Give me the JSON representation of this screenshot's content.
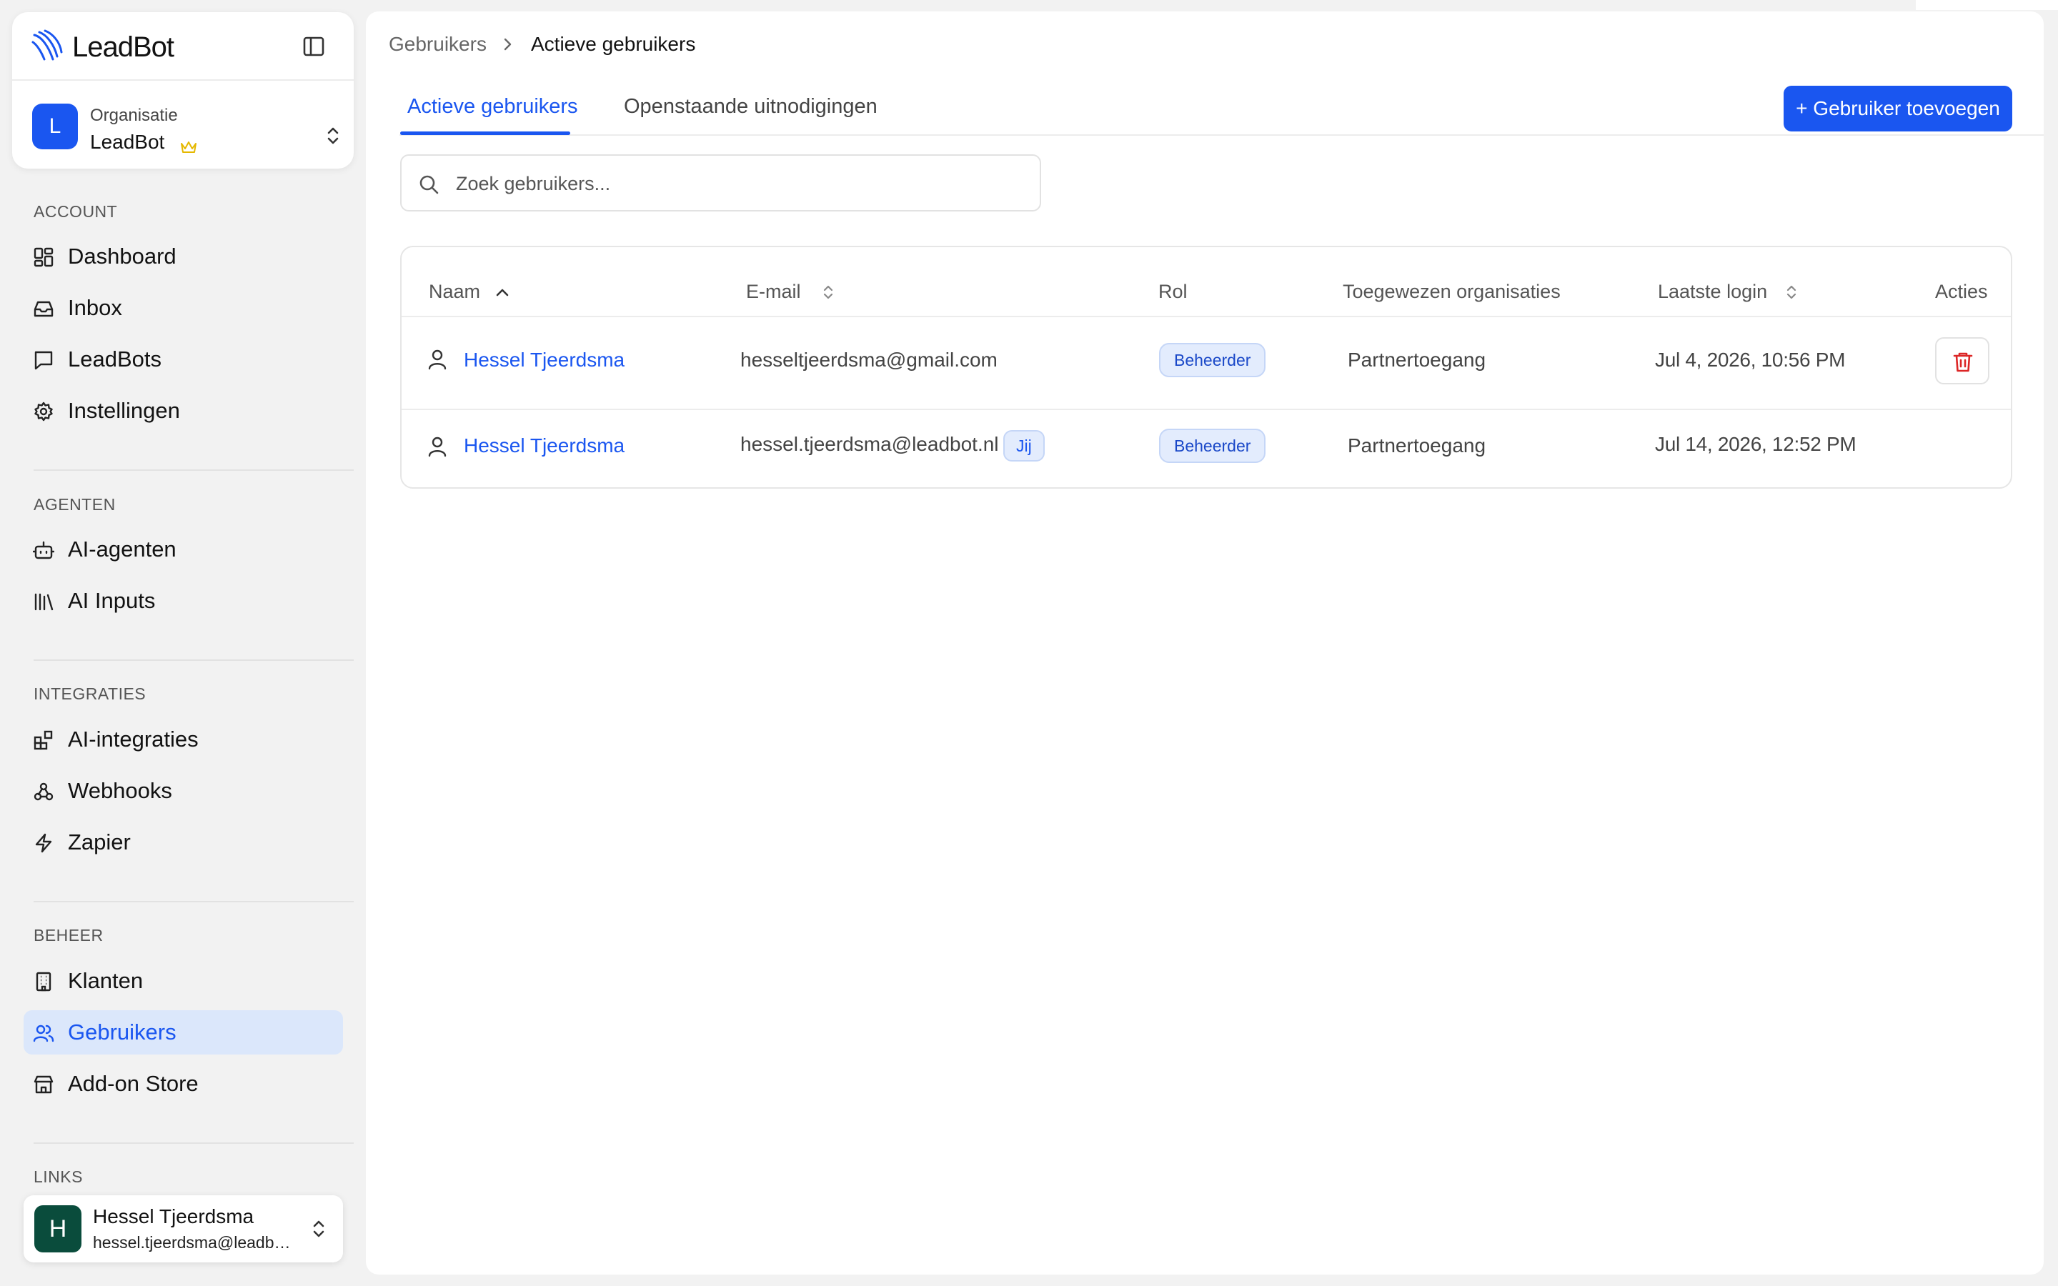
{
  "brand": {
    "name": "LeadBot"
  },
  "organization": {
    "label": "Organisatie",
    "name": "LeadBot",
    "avatar_letter": "L"
  },
  "sidebar": {
    "sections": [
      {
        "label": "ACCOUNT",
        "items": [
          {
            "label": "Dashboard",
            "icon": "dashboard-icon"
          },
          {
            "label": "Inbox",
            "icon": "inbox-icon"
          },
          {
            "label": "LeadBots",
            "icon": "chat-icon"
          },
          {
            "label": "Instellingen",
            "icon": "gear-icon"
          }
        ]
      },
      {
        "label": "AGENTEN",
        "items": [
          {
            "label": "AI-agenten",
            "icon": "bot-icon"
          },
          {
            "label": "AI Inputs",
            "icon": "library-icon"
          }
        ]
      },
      {
        "label": "INTEGRATIES",
        "items": [
          {
            "label": "AI-integraties",
            "icon": "blocks-icon"
          },
          {
            "label": "Webhooks",
            "icon": "webhook-icon"
          },
          {
            "label": "Zapier",
            "icon": "zap-icon"
          }
        ]
      },
      {
        "label": "BEHEER",
        "items": [
          {
            "label": "Klanten",
            "icon": "building-icon"
          },
          {
            "label": "Gebruikers",
            "icon": "users-icon",
            "active": true
          },
          {
            "label": "Add-on Store",
            "icon": "store-icon"
          }
        ]
      },
      {
        "label": "LINKS",
        "items": []
      }
    ]
  },
  "current_user": {
    "avatar_letter": "H",
    "name": "Hessel Tjeerdsma",
    "email": "hessel.tjeerdsma@leadbot.nl"
  },
  "breadcrumb": {
    "parent": "Gebruikers",
    "current": "Actieve gebruikers"
  },
  "tabs": [
    {
      "label": "Actieve gebruikers",
      "active": true
    },
    {
      "label": "Openstaande uitnodigingen",
      "active": false
    }
  ],
  "add_button": {
    "label": "+ Gebruiker toevoegen"
  },
  "search": {
    "placeholder": "Zoek gebruikers...",
    "value": ""
  },
  "table": {
    "columns": [
      "Naam",
      "E-mail",
      "Rol",
      "Toegewezen organisaties",
      "Laatste login",
      "Acties"
    ],
    "rows": [
      {
        "name": "Hessel Tjeerdsma",
        "email": "hesseltjeerdsma@gmail.com",
        "you": "",
        "role": "Beheerder",
        "orgs": "Partnertoegang",
        "last_login": "Jul 4, 2026, 10:56 PM",
        "can_delete": true
      },
      {
        "name": "Hessel Tjeerdsma",
        "email": "hessel.tjeerdsma@leadbot.nl",
        "you": "Jij",
        "role": "Beheerder",
        "orgs": "Partnertoegang",
        "last_login": "Jul 14, 2026, 12:52 PM",
        "can_delete": false
      }
    ]
  },
  "colors": {
    "accent": "#1a56f0",
    "danger": "#dc2626",
    "user_avatar": "#0a4c3c",
    "active_nav_bg": "#dbe7fb"
  }
}
